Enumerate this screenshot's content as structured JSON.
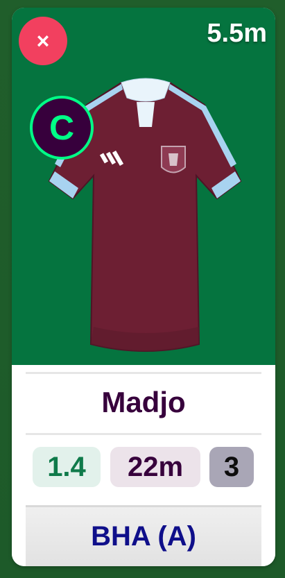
{
  "card": {
    "close_label": "×",
    "price": "5.5m",
    "captain_badge": "C",
    "player_name": "Madjo",
    "stats": {
      "form": "1.4",
      "selected": "22m",
      "points": "3"
    },
    "fixture": "BHA (A)"
  },
  "colors": {
    "pitch": "#05743f",
    "close_button": "#f2405f",
    "captain_ring": "#00ff87",
    "captain_fill": "#37003c",
    "name": "#37003c",
    "fixture_text": "#0f0f8a",
    "shirt": "#6d1f33",
    "shirt_trim": "#a8d3f0"
  },
  "icons": {
    "close": "close-icon",
    "shirt": "football-shirt-icon",
    "crest": "club-crest-icon",
    "brand": "brand-stripes-icon"
  }
}
